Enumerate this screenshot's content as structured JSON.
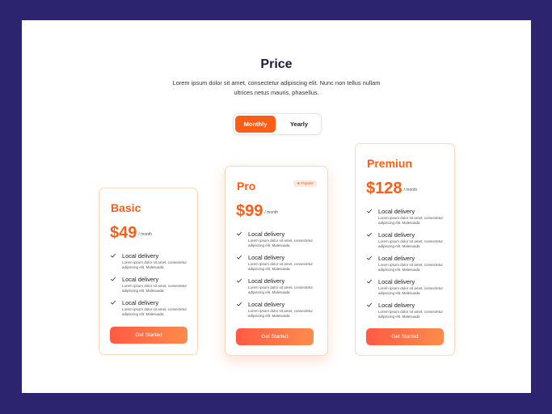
{
  "header": {
    "title": "Price",
    "subtitle": "Lorem ipsum dolor sit amet, consectetur adipiscing elit. Nunc non tellus nullam ultrices netus mauris, phasellus."
  },
  "billing_toggle": {
    "monthly_label": "Monthly",
    "yearly_label": "Yearly",
    "selected": "Monthly"
  },
  "colors": {
    "accent": "#fe5d16",
    "background": "#2d2470",
    "button_start": "#fe5b43",
    "button_end": "#fe8b4d"
  },
  "plans": [
    {
      "name": "Basic",
      "price": "$49",
      "period": "/ month",
      "features": [
        {
          "icon": "check-icon",
          "title": "Local delivery",
          "desc": "Lorem ipsum dolor sit amet, consectetur adipiscing elit. Malesuada"
        },
        {
          "icon": "check-icon",
          "title": "Local delivery",
          "desc": "Lorem ipsum dolor sit amet, consectetur adipiscing elit. Malesuada"
        },
        {
          "icon": "check-icon",
          "title": "Local delivery",
          "desc": "Lorem ipsum dolor sit amet, consectetur adipiscing elit. Malesuada"
        }
      ],
      "cta": "Get Started"
    },
    {
      "name": "Pro",
      "badge": "Popular",
      "badge_icon": "star-icon",
      "price": "$99",
      "period": "/ month",
      "features": [
        {
          "icon": "check-icon",
          "title": "Local delivery",
          "desc": "Lorem ipsum dolor sit amet, consectetur adipiscing elit. Malesuada"
        },
        {
          "icon": "check-icon",
          "title": "Local delivery",
          "desc": "Lorem ipsum dolor sit amet, consectetur adipiscing elit. Malesuada"
        },
        {
          "icon": "check-icon",
          "title": "Local delivery",
          "desc": "Lorem ipsum dolor sit amet, consectetur adipiscing elit. Malesuada"
        },
        {
          "icon": "check-icon",
          "title": "Local delivery",
          "desc": "Lorem ipsum dolor sit amet, consectetur adipiscing elit. Malesuada"
        }
      ],
      "cta": "Get Started"
    },
    {
      "name": "Premiun",
      "price": "$128",
      "period": "/ month",
      "features": [
        {
          "icon": "check-icon",
          "title": "Local delivery",
          "desc": "Lorem ipsum dolor sit amet, consectetur adipiscing elit. Malesuada"
        },
        {
          "icon": "check-icon",
          "title": "Local delivery",
          "desc": "Lorem ipsum dolor sit amet, consectetur adipiscing elit. Malesuada"
        },
        {
          "icon": "check-icon",
          "title": "Local delivery",
          "desc": "Lorem ipsum dolor sit amet, consectetur adipiscing elit. Malesuada"
        },
        {
          "icon": "check-icon",
          "title": "Local delivery",
          "desc": "Lorem ipsum dolor sit amet, consectetur adipiscing elit. Malesuada"
        },
        {
          "icon": "check-icon",
          "title": "Local delivery",
          "desc": "Lorem ipsum dolor sit amet, consectetur adipiscing elit. Malesuada"
        }
      ],
      "cta": "Get Started"
    }
  ]
}
